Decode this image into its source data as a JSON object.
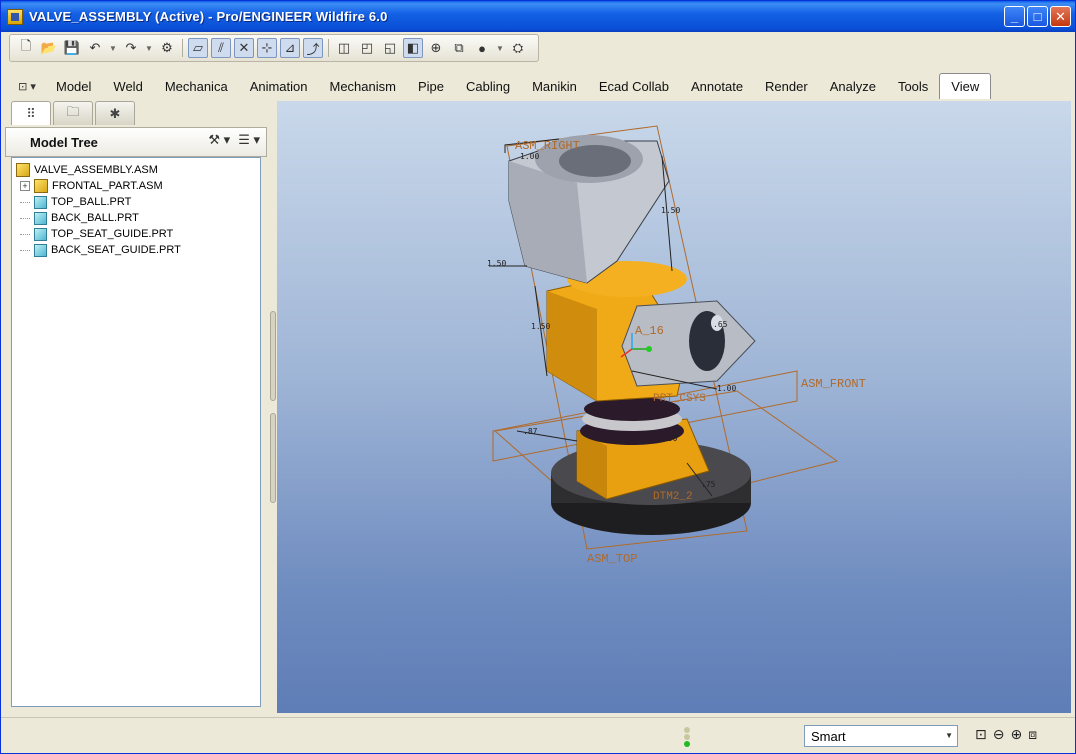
{
  "window": {
    "title": "VALVE_ASSEMBLY (Active) - Pro/ENGINEER Wildfire 6.0",
    "buttons": {
      "minimize": "_",
      "maximize": "□",
      "close": "✕"
    }
  },
  "toolbar": {
    "icons": {
      "new": "🗋",
      "open": "📂",
      "save": "💾",
      "undo": "↶",
      "redo": "↷",
      "regen": "⚙",
      "datum_planes": "▱",
      "datum_axes": "⫽",
      "datum_points": "✕",
      "csys": "⊹",
      "annotations": "⊿",
      "spin_center": "⤴",
      "wireframe": "◫",
      "hidden_line": "◰",
      "no_hidden": "◱",
      "shading": "◧",
      "view_manager": "⊕",
      "reorient": "⧉",
      "appearance": "●",
      "binoculars": "⛭"
    }
  },
  "menu": {
    "items": [
      "Model",
      "Weld",
      "Mechanica",
      "Animation",
      "Mechanism",
      "Pipe",
      "Cabling",
      "Manikin",
      "Ecad Collab",
      "Annotate",
      "Render",
      "Analyze",
      "Tools",
      "View"
    ],
    "active": "View"
  },
  "left_panel": {
    "tabs": [
      "model-tree",
      "folder-browser",
      "favorites"
    ],
    "tree_title": "Model Tree",
    "tree": [
      {
        "label": "VALVE_ASSEMBLY.ASM",
        "kind": "asm",
        "level": 0,
        "expander": ""
      },
      {
        "label": "FRONTAL_PART.ASM",
        "kind": "asm",
        "level": 1,
        "expander": "+"
      },
      {
        "label": "TOP_BALL.PRT",
        "kind": "prt",
        "level": 1,
        "expander": ""
      },
      {
        "label": "BACK_BALL.PRT",
        "kind": "prt",
        "level": 1,
        "expander": ""
      },
      {
        "label": "TOP_SEAT_GUIDE.PRT",
        "kind": "prt",
        "level": 1,
        "expander": ""
      },
      {
        "label": "BACK_SEAT_GUIDE.PRT",
        "kind": "prt",
        "level": 1,
        "expander": ""
      }
    ]
  },
  "viewport": {
    "labels": {
      "asm_right": "ASM_RIGHT",
      "asm_front": "ASM_FRONT",
      "asm_top": "ASM_TOP",
      "axis": "A_16",
      "csys": "PRT_CSYS",
      "plane": "DTM2_2"
    },
    "dims": [
      "1.00",
      "1.50",
      "1.50",
      "1.50",
      ".65",
      "1.00",
      ".87",
      ".50",
      ".75"
    ],
    "colors": {
      "nut": "#b8bcc4",
      "body": "#e8a010",
      "base": "#2a2a2c",
      "datum": "#b06a2a"
    }
  },
  "status": {
    "filter": "Smart",
    "icons": {
      "zoom_fit": "⊡",
      "zoom_out": "⊖",
      "zoom_in": "⊕",
      "sel_box": "⧈"
    }
  }
}
